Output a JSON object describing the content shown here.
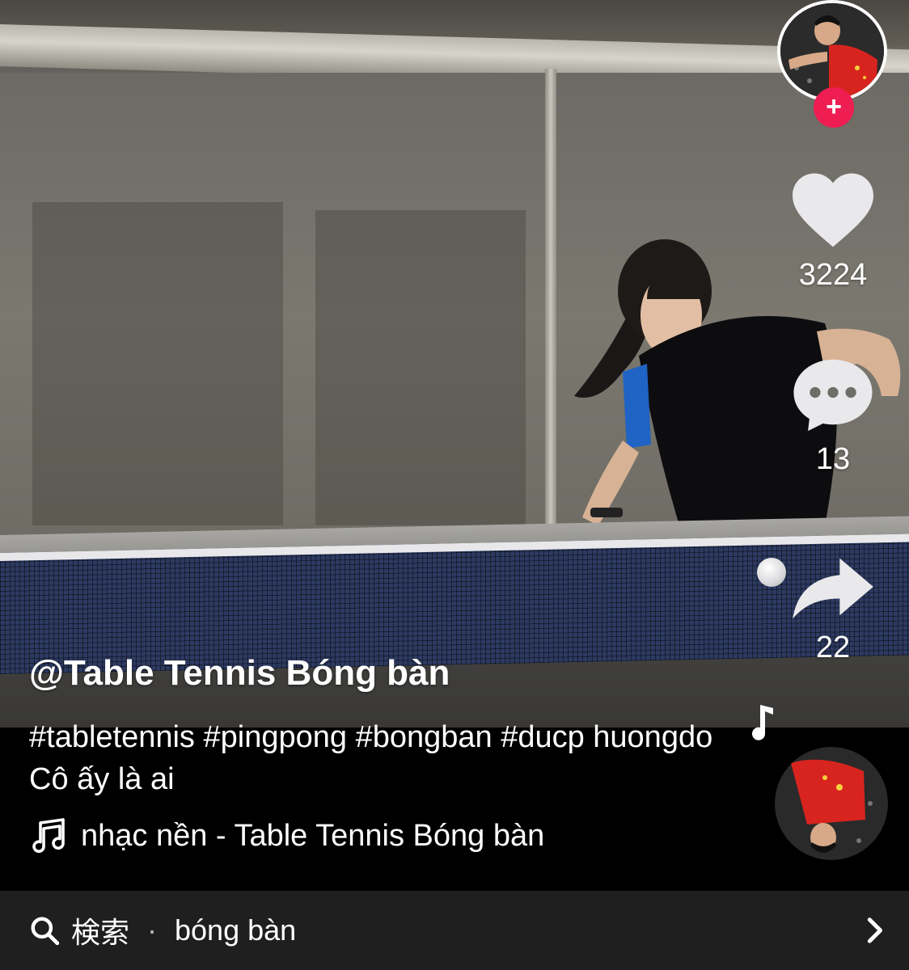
{
  "post": {
    "username": "@Table Tennis Bóng bàn",
    "caption": "#tabletennis  #pingpong  #bongban  #ducp huongdo Cô ấy là ai",
    "music": "nhạc nền - Table Tennis Bóng bàn"
  },
  "actions": {
    "like_count": "3224",
    "comment_count": "13",
    "share_count": "22",
    "follow_label": "+"
  },
  "search": {
    "label": "検索",
    "separator": "·",
    "query": "bóng bàn"
  },
  "colors": {
    "follow": "#ee1d52",
    "search_bar_bg": "#1f1f1f"
  },
  "icons": [
    "heart-icon",
    "comment-icon",
    "share-icon",
    "music-note-icon",
    "search-icon",
    "chevron-right-icon"
  ]
}
